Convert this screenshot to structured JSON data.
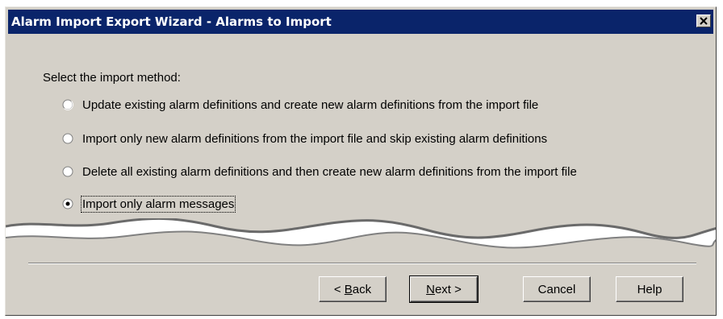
{
  "window": {
    "title": "Alarm Import Export Wizard - Alarms to Import"
  },
  "content": {
    "prompt": "Select the import method:",
    "options": [
      {
        "label": "Update existing alarm definitions and create new alarm definitions from the import file",
        "selected": false
      },
      {
        "label": "Import only new alarm definitions from the import file and skip existing alarm definitions",
        "selected": false
      },
      {
        "label": "Delete all existing alarm definitions and then create new alarm definitions from the import file",
        "selected": false
      },
      {
        "label": "Import only alarm messages",
        "selected": true
      }
    ]
  },
  "buttons": {
    "back_prefix": "< ",
    "back_mnemonic": "B",
    "back_rest": "ack",
    "next_mnemonic": "N",
    "next_rest": "ext >",
    "cancel": "Cancel",
    "help": "Help"
  },
  "icons": {
    "close": "close-icon",
    "radio_off": "radio-unselected-icon",
    "radio_on": "radio-selected-icon"
  },
  "colors": {
    "titlebar": "#0a246a",
    "dialog": "#d4d0c8"
  }
}
